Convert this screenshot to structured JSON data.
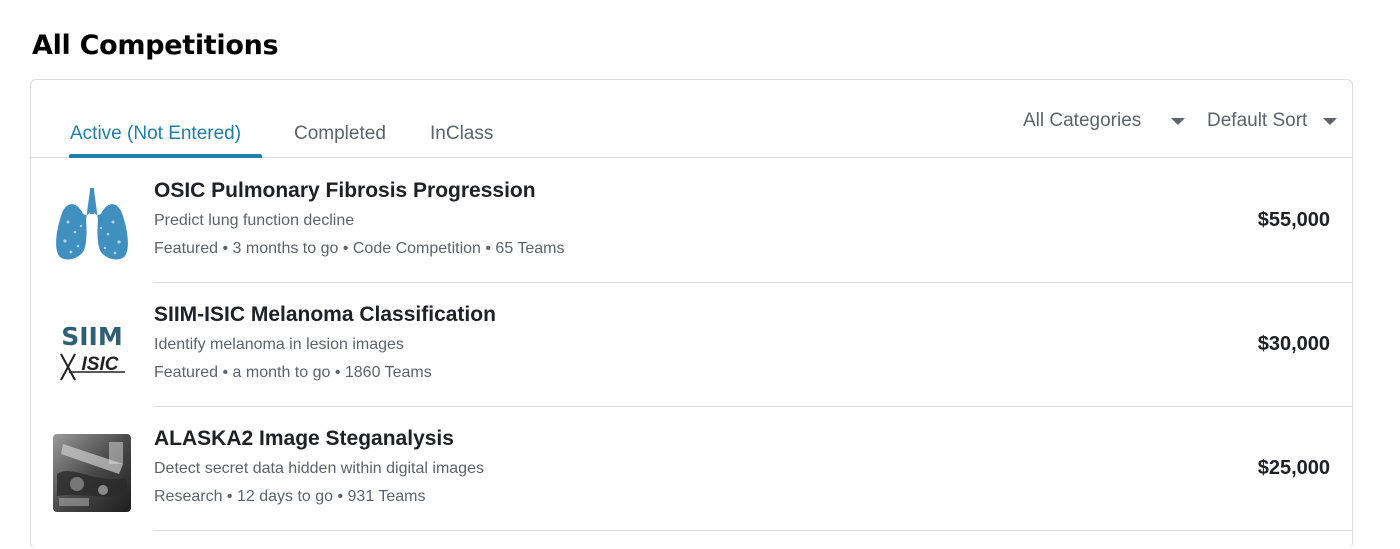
{
  "page": {
    "title": "All Competitions"
  },
  "tabs": [
    {
      "label": "Active (Not Entered)",
      "active": true
    },
    {
      "label": "Completed",
      "active": false
    },
    {
      "label": "InClass",
      "active": false
    }
  ],
  "filters": {
    "category": "All Categories",
    "sort": "Default Sort"
  },
  "competitions": [
    {
      "title": "OSIC Pulmonary Fibrosis Progression",
      "subtitle": "Predict lung function decline",
      "meta": "Featured • 3 months to go • Code Competition • 65 Teams",
      "prize": "$55,000",
      "thumbnail": "lungs-icon"
    },
    {
      "title": "SIIM-ISIC Melanoma Classification",
      "subtitle": "Identify melanoma in lesion images",
      "meta": "Featured • a month to go • 1860 Teams",
      "prize": "$30,000",
      "thumbnail": "siim-isic-logo",
      "logo_text_top": "SIIM",
      "logo_text_bottom": "ISIC"
    },
    {
      "title": "ALASKA2 Image Steganalysis",
      "subtitle": "Detect secret data hidden within digital images",
      "meta": "Research • 12 days to go • 931 Teams",
      "prize": "$25,000",
      "thumbnail": "steganalysis-photo"
    }
  ],
  "colors": {
    "accent": "#1f7fa8",
    "lung_blue": "#3f8fbf",
    "siim_teal": "#2e5f73",
    "text_primary": "#202124",
    "text_secondary": "#5f6368",
    "divider": "#dadce0"
  }
}
